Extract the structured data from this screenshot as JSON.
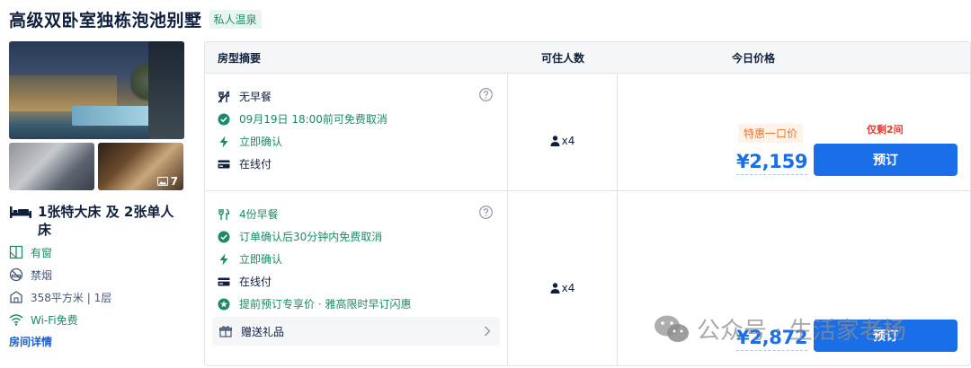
{
  "room": {
    "title": "高级双卧室独栋泡池别墅",
    "tag": "私人温泉",
    "photo_count": "7",
    "bed": "1张特大床 及 2张单人床",
    "facilities": [
      {
        "icon": "window-icon",
        "label": "有窗"
      },
      {
        "icon": "no-smoking-icon",
        "label": "禁烟"
      },
      {
        "icon": "area-icon",
        "label": "358平方米 | 1层"
      },
      {
        "icon": "wifi-icon",
        "label": "Wi-Fi免费"
      }
    ],
    "detail_link": "房间详情"
  },
  "table": {
    "headers": {
      "summary": "房型摘要",
      "occupancy": "可住人数",
      "price": "今日价格"
    },
    "rows": [
      {
        "policies": [
          {
            "icon": "no-breakfast-icon",
            "text": "无早餐",
            "green": false
          },
          {
            "icon": "check-circle-icon",
            "text": "09月19日 18:00前可免费取消",
            "green": true
          },
          {
            "icon": "lightning-icon",
            "text": "立即确认",
            "green": true
          },
          {
            "icon": "card-icon",
            "text": "在线付",
            "green": false
          }
        ],
        "occupancy": "x4",
        "deal_tag": "特惠一口价",
        "price": "¥2,159",
        "remaining": "仅剩2间",
        "book_label": "预订"
      },
      {
        "policies": [
          {
            "icon": "breakfast-icon",
            "text": "4份早餐",
            "green": true
          },
          {
            "icon": "check-circle-icon",
            "text": "订单确认后30分钟内免费取消",
            "green": true
          },
          {
            "icon": "lightning-icon",
            "text": "立即确认",
            "green": true
          },
          {
            "icon": "card-icon",
            "text": "在线付",
            "green": false
          },
          {
            "icon": "star-badge-icon",
            "text": "提前预订专享价 · 雅高限时早订闪惠",
            "green": true
          }
        ],
        "gift": "赠送礼品",
        "occupancy": "x4",
        "price": "¥2,872",
        "book_label": "预订"
      }
    ]
  },
  "watermark": "公众号 · 生活家老杨"
}
